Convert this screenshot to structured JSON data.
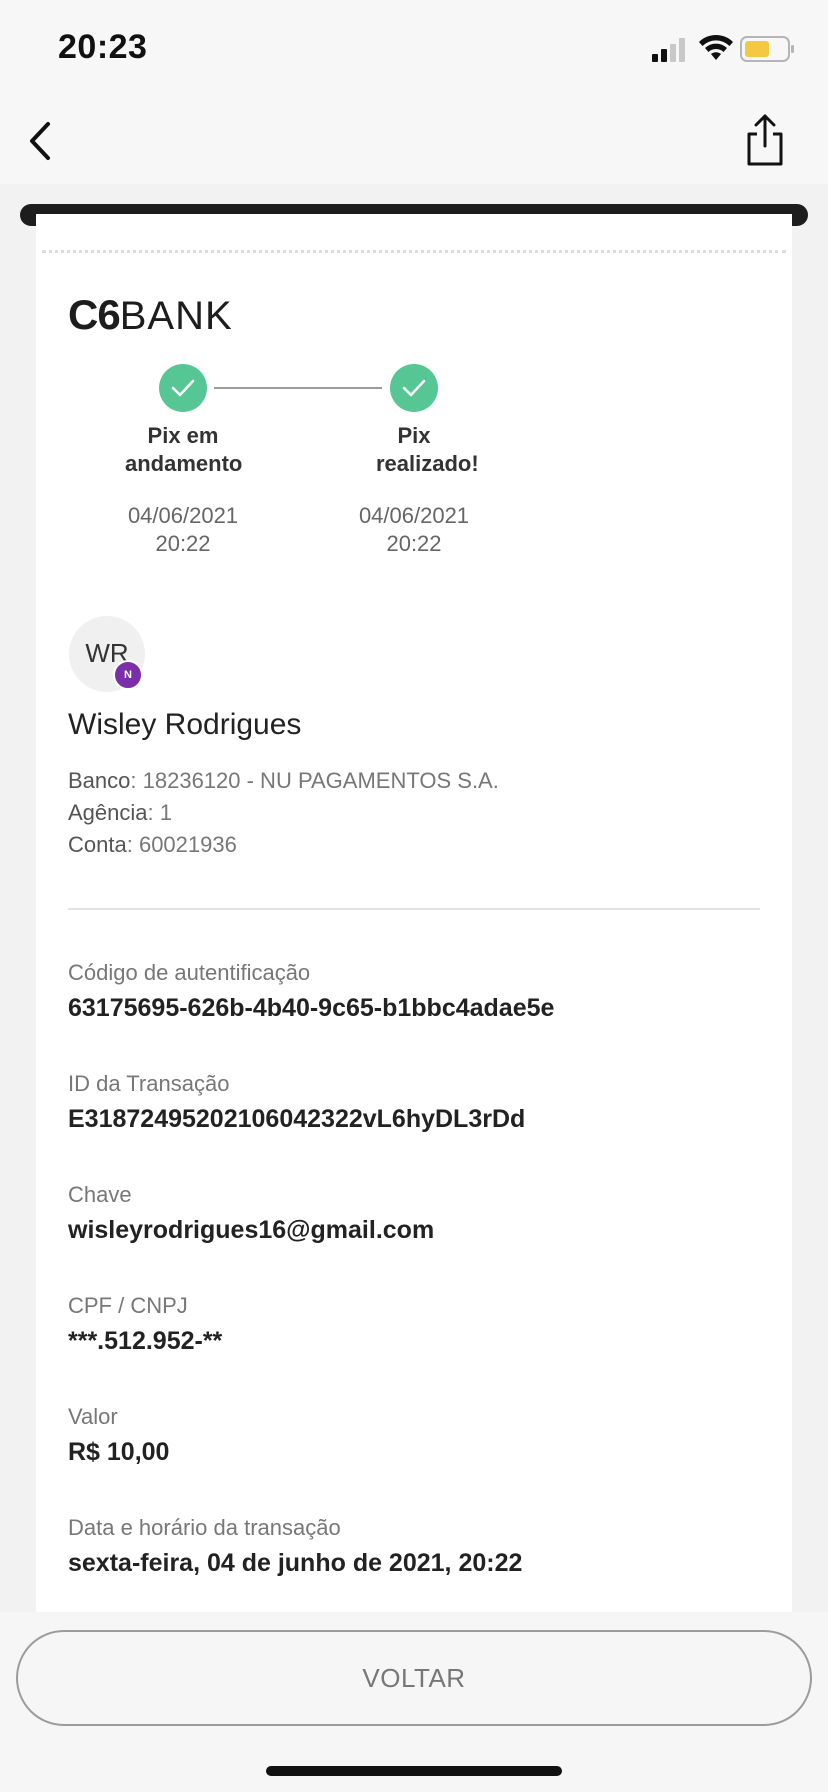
{
  "status_bar": {
    "time": "20:23"
  },
  "logo": {
    "c6": "C6",
    "bank": "BANK"
  },
  "timeline": [
    {
      "title": "Pix em andamento",
      "date": "04/06/2021",
      "time": "20:22"
    },
    {
      "title": "Pix realizado!",
      "date": "04/06/2021",
      "time": "20:22"
    }
  ],
  "recipient": {
    "initials": "WR",
    "bank_badge": "N",
    "name": "Wisley Rodrigues",
    "bank_label": "Banco",
    "bank_value": "18236120 - NU PAGAMENTOS S.A.",
    "agency_label": "Agência",
    "agency_value": "1",
    "account_label": "Conta",
    "account_value": "60021936"
  },
  "fields": [
    {
      "label": "Código de autentificação",
      "value": "63175695-626b-4b40-9c65-b1bbc4adae5e"
    },
    {
      "label": "ID da Transação",
      "value": "E31872495202106042322vL6hyDL3rDd"
    },
    {
      "label": "Chave",
      "value": "wisleyrodrigues16@gmail.com"
    },
    {
      "label": "CPF / CNPJ",
      "value": "***.512.952-**"
    },
    {
      "label": "Valor",
      "value": "R$ 10,00"
    },
    {
      "label": "Data e horário da transação",
      "value": "sexta-feira, 04 de junho de 2021, 20:22"
    }
  ],
  "actions": {
    "back_button": "VOLTAR"
  },
  "colors": {
    "success": "#56c695",
    "nubank_purple": "#7a2ea8",
    "receipt_bar": "#1d1d1d",
    "battery_fill": "#f5c842"
  },
  "icons": {
    "back": "chevron-left-icon",
    "share": "share-icon",
    "step": "check-icon"
  }
}
